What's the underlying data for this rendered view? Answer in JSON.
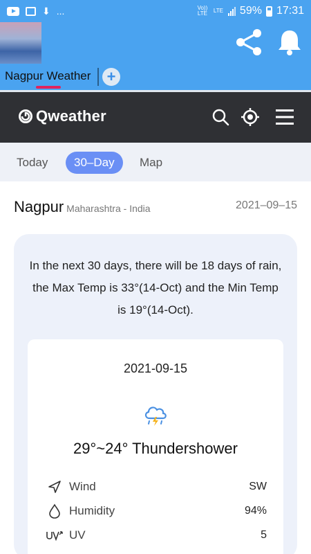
{
  "status_bar": {
    "vo_lte": "Vo)) LTE",
    "lte": "LTE",
    "battery": "59%",
    "time": "17:31",
    "ellipsis": "..."
  },
  "header": {
    "city_tab": "Nagpur Weather",
    "add_tab": "+"
  },
  "nav": {
    "logo": "Qweather"
  },
  "segments": {
    "today": "Today",
    "thirty_day": "30–Day",
    "map": "Map"
  },
  "location": {
    "city": "Nagpur",
    "region": "Maharashtra - India",
    "date": "2021–09–15"
  },
  "summary": {
    "text": "In the next 30 days, there will be 18 days of rain, the Max Temp is 33°(14-Oct) and the Min Temp is 19°(14-Oct)."
  },
  "day": {
    "date": "2021-09-15",
    "icon": "thunder-cloud-icon",
    "temp_desc": "29°~24° Thundershower",
    "details": [
      {
        "label": "Wind",
        "value": "SW",
        "icon": "wind-arrow-icon"
      },
      {
        "label": "Humidity",
        "value": "94%",
        "icon": "droplet-icon"
      },
      {
        "label": "UV",
        "value": "5",
        "icon": "uv-icon"
      }
    ]
  },
  "colors": {
    "header_blue": "#4aa3f0",
    "nav_dark": "#2f3034",
    "active_tab": "#6a8ff5",
    "underline_pink": "#e0245e"
  }
}
